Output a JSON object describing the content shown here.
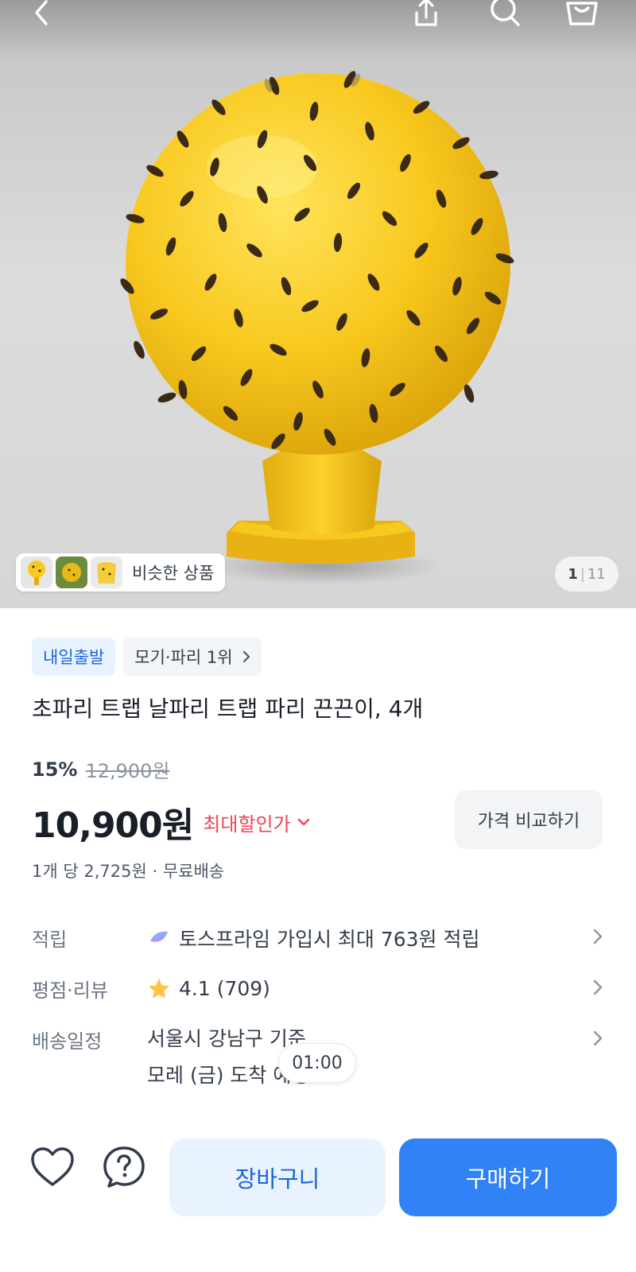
{
  "header": {
    "icons": [
      "back-icon",
      "share-icon",
      "search-icon",
      "shopping-bag-icon"
    ]
  },
  "gallery": {
    "similar_label": "비슷한 상품",
    "page_current": "1",
    "page_total": "11"
  },
  "product": {
    "badges": [
      "내일출발",
      "모기·파리 1위"
    ],
    "title": "초파리 트랩 날파리 트랩 파리 끈끈이, 4개",
    "discount_rate": "15%",
    "original_price": "12,900원",
    "price": "10,900원",
    "max_discount_label": "최대할인가",
    "compare_label": "가격 비교하기",
    "unit_price": "1개 당 2,725원 · 무료배송"
  },
  "info": {
    "point_label": "적립",
    "point_value": "토스프라임 가입시 최대 763원 적립",
    "rating_label": "평점·리뷰",
    "rating_value": "4.1 (709)",
    "shipping_label": "배송일정",
    "shipping_line1": "서울시 강남구 기준",
    "shipping_line2": "모레 (금) 도착 예정"
  },
  "timer": "01:00",
  "bottom_bar": {
    "cart_label": "장바구니",
    "buy_label": "구매하기"
  },
  "colors": {
    "primary": "#3182f6",
    "primary_light": "#e8f3ff",
    "discount_red": "#f04452",
    "product_yellow": "#f7c51f",
    "star": "#ffc342"
  }
}
